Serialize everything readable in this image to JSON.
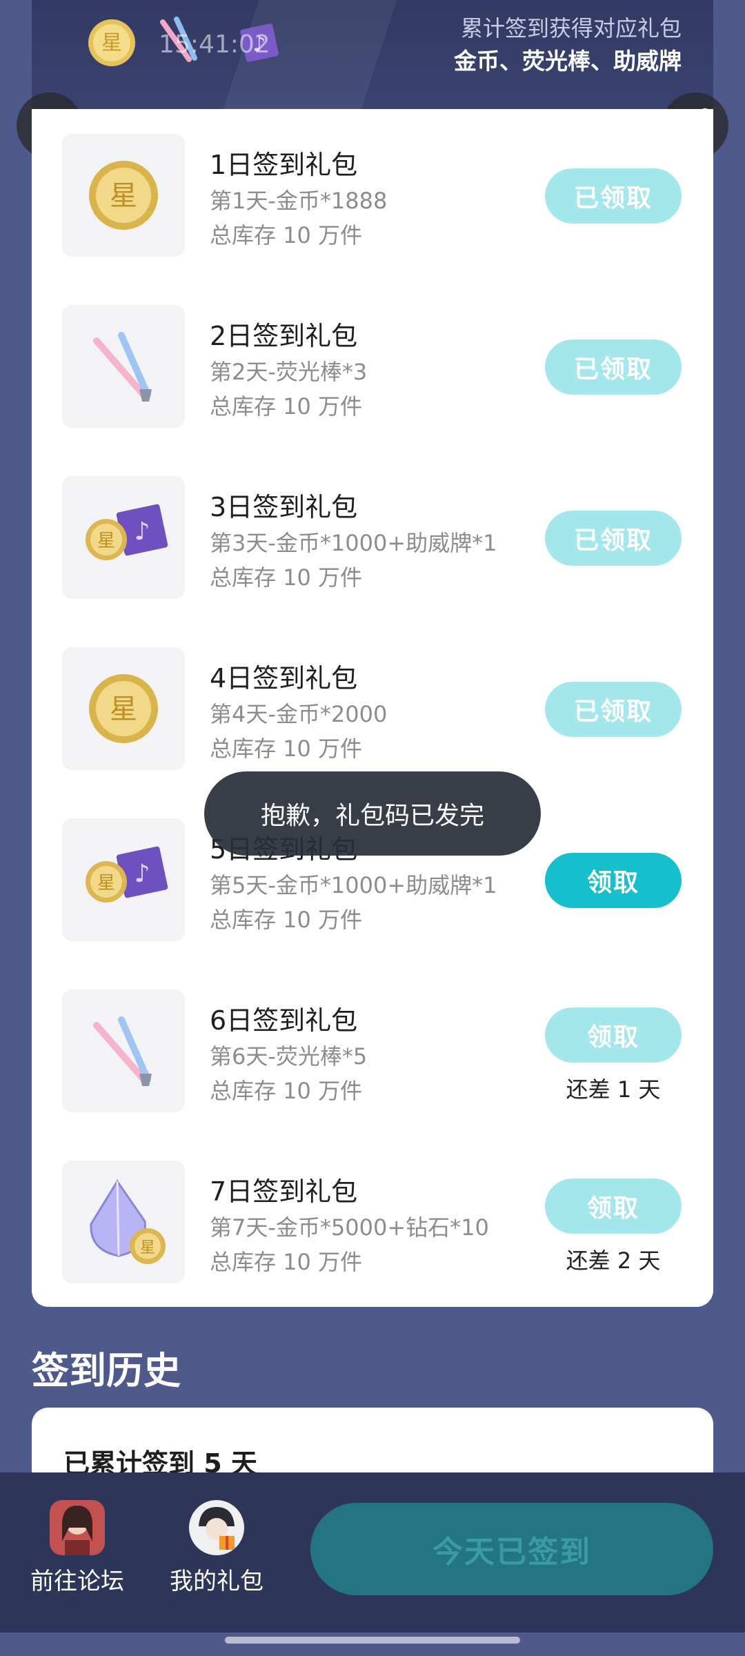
{
  "header": {
    "subtitle": "累计签到获得对应礼包",
    "title": "金币、荧光棒、助威牌",
    "status_time": "15:41:02",
    "status_icons": [
      "alarm-icon",
      "hd-icon",
      "mute-icon",
      "signal-icon",
      "battery-icon"
    ]
  },
  "gifts": [
    {
      "title": "1日签到礼包",
      "desc": "第1天-金币*1888",
      "stock": "总库存 10 万件",
      "button": "已领取",
      "remain": "",
      "icon": "coin-icon"
    },
    {
      "title": "2日签到礼包",
      "desc": "第2天-荧光棒*3",
      "stock": "总库存 10 万件",
      "button": "已领取",
      "remain": "",
      "icon": "glowstick-icon"
    },
    {
      "title": "3日签到礼包",
      "desc": "第3天-金币*1000+助威牌*1",
      "stock": "总库存 10 万件",
      "button": "已领取",
      "remain": "",
      "icon": "coin-and-sign-icon"
    },
    {
      "title": "4日签到礼包",
      "desc": "第4天-金币*2000",
      "stock": "总库存 10 万件",
      "button": "已领取",
      "remain": "",
      "icon": "coin-icon"
    },
    {
      "title": "5日签到礼包",
      "desc": "第5天-金币*1000+助威牌*1",
      "stock": "总库存 10 万件",
      "button": "领取",
      "remain": "",
      "icon": "coin-and-sign-icon"
    },
    {
      "title": "6日签到礼包",
      "desc": "第6天-荧光棒*5",
      "stock": "总库存 10 万件",
      "button": "领取",
      "remain": "还差 1 天",
      "icon": "glowstick-icon"
    },
    {
      "title": "7日签到礼包",
      "desc": "第7天-金币*5000+钻石*10",
      "stock": "总库存 10 万件",
      "button": "领取",
      "remain": "还差 2 天",
      "icon": "diamond-and-coin-icon"
    }
  ],
  "toast": "抱歉，礼包码已发完",
  "history": {
    "title": "签到历史",
    "count": "已累计签到 5 天"
  },
  "bottom": {
    "forum_label": "前往论坛",
    "gifts_label": "我的礼包",
    "checkin_label": "今天已签到"
  },
  "colors": {
    "background": "#4f5a8c",
    "button_claimed": "#a3e6ec",
    "button_active": "#15c0cc",
    "checkin_disabled": "#237583"
  }
}
